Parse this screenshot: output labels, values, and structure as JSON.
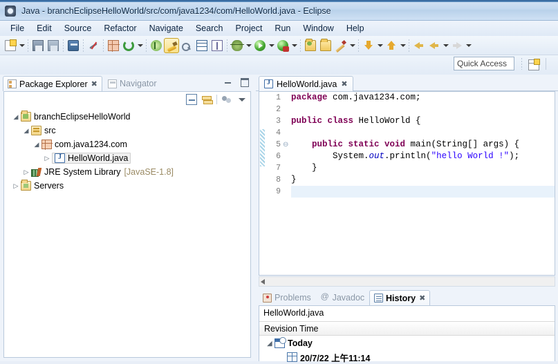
{
  "window": {
    "title": "Java - branchEclipseHelloWorld/src/com/java1234/com/HelloWorld.java - Eclipse",
    "app_icon": "eclipse-icon"
  },
  "menubar": {
    "items": [
      {
        "label": "File"
      },
      {
        "label": "Edit"
      },
      {
        "label": "Source"
      },
      {
        "label": "Refactor"
      },
      {
        "label": "Navigate"
      },
      {
        "label": "Search"
      },
      {
        "label": "Project"
      },
      {
        "label": "Run"
      },
      {
        "label": "Window"
      },
      {
        "label": "Help"
      }
    ]
  },
  "toolbar": {
    "buttons": [
      {
        "name": "new-wizard-icon",
        "icon": "ic-doc",
        "dropdown": true
      },
      {
        "sep": true
      },
      {
        "name": "save-icon",
        "icon": "ic-save"
      },
      {
        "name": "save-all-icon",
        "icon": "ic-saveall"
      },
      {
        "sep": true
      },
      {
        "name": "console-icon",
        "icon": "ic-console"
      },
      {
        "sep": true
      },
      {
        "name": "skip-breakpoints-icon",
        "icon": "ic-link"
      },
      {
        "sep": true
      },
      {
        "name": "new-java-class-icon",
        "icon": "ic-newclass"
      },
      {
        "name": "refresh-icon",
        "icon": "ic-refresh",
        "dropdown": true
      },
      {
        "sep": true
      },
      {
        "name": "debug-config-icon",
        "icon": "ic-debugc"
      },
      {
        "name": "brush-icon",
        "icon": "ic-brush",
        "selected": true
      },
      {
        "name": "search-next-icon",
        "icon": "ic-search2"
      },
      {
        "name": "open-task-icon",
        "icon": "ic-table"
      },
      {
        "name": "toggle-markers-icon",
        "icon": "ic-tbar"
      },
      {
        "sep": true
      },
      {
        "name": "debug-icon",
        "icon": "ic-bug",
        "dropdown": true
      },
      {
        "name": "run-icon",
        "icon": "ic-run",
        "dropdown": true
      },
      {
        "name": "coverage-icon",
        "icon": "ic-runred",
        "dropdown": true
      },
      {
        "sep": true
      },
      {
        "name": "open-type-icon",
        "icon": "ic-folder g"
      },
      {
        "name": "open-resource-icon",
        "icon": "ic-folder"
      },
      {
        "name": "external-tools-icon",
        "icon": "ic-pencil",
        "dropdown": true
      },
      {
        "sep": true
      },
      {
        "name": "previous-annotation-icon",
        "icon": "ic-down",
        "dropdown": true
      },
      {
        "name": "next-annotation-icon",
        "icon": "ic-up",
        "dropdown": true
      },
      {
        "sep": true
      },
      {
        "name": "back-icon",
        "icon": "ic-back"
      },
      {
        "name": "backward-history-icon",
        "icon": "ic-back",
        "dropdown": true
      },
      {
        "name": "forward-history-icon",
        "icon": "ic-fwd",
        "dropdown": true
      }
    ]
  },
  "quick_access": {
    "placeholder": "Quick Access",
    "value": "",
    "perspective_icon": "open-perspective-icon"
  },
  "package_explorer": {
    "tabs": [
      {
        "label": "Package Explorer",
        "icon": "package-explorer-icon",
        "active": true,
        "closable": true
      },
      {
        "label": "Navigator",
        "icon": "navigator-icon",
        "active": false,
        "closable": false
      }
    ],
    "window_buttons": [
      {
        "name": "minimize-button"
      },
      {
        "name": "maximize-button"
      }
    ],
    "view_tools": [
      {
        "name": "collapse-all-icon"
      },
      {
        "name": "link-with-editor-icon"
      },
      {
        "name": "view-filter-icon"
      },
      {
        "name": "view-menu-icon"
      }
    ],
    "tree": [
      {
        "label": "branchEclipseHelloWorld",
        "icon": "project-icon",
        "indent": 0,
        "twisty": "expanded",
        "selected": false
      },
      {
        "label": "src",
        "icon": "source-folder-icon",
        "indent": 1,
        "twisty": "expanded",
        "selected": false
      },
      {
        "label": "com.java1234.com",
        "icon": "package-icon",
        "indent": 2,
        "twisty": "expanded",
        "selected": false
      },
      {
        "label": "HelloWorld.java",
        "icon": "java-file-icon",
        "indent": 3,
        "twisty": "collapsed",
        "selected": true
      },
      {
        "label": "JRE System Library",
        "suffix": "[JavaSE-1.8]",
        "icon": "jre-library-icon",
        "indent": 1,
        "twisty": "collapsed",
        "selected": false
      },
      {
        "label": "Servers",
        "icon": "servers-folder-icon",
        "indent": 0,
        "twisty": "collapsed",
        "selected": false
      }
    ]
  },
  "editor": {
    "tab": {
      "label": "HelloWorld.java",
      "icon": "java-file-icon",
      "closable": true
    },
    "lines": [
      {
        "num": "1",
        "fold": false,
        "tokens": [
          {
            "t": "package",
            "c": "kw"
          },
          {
            "t": " com.java1234.com;",
            "c": ""
          }
        ]
      },
      {
        "num": "2",
        "fold": false,
        "tokens": []
      },
      {
        "num": "3",
        "fold": false,
        "tokens": [
          {
            "t": "public class",
            "c": "kw"
          },
          {
            "t": " HelloWorld {",
            "c": ""
          }
        ]
      },
      {
        "num": "4",
        "fold": false,
        "tokens": []
      },
      {
        "num": "5",
        "fold": true,
        "tokens": [
          {
            "t": "    ",
            "c": ""
          },
          {
            "t": "public static void",
            "c": "kw"
          },
          {
            "t": " main(String[] args) {",
            "c": ""
          }
        ]
      },
      {
        "num": "6",
        "fold": false,
        "tokens": [
          {
            "t": "        System.",
            "c": ""
          },
          {
            "t": "out",
            "c": "fld"
          },
          {
            "t": ".println(",
            "c": ""
          },
          {
            "t": "\"hello World !\"",
            "c": "str"
          },
          {
            "t": ");",
            "c": ""
          }
        ]
      },
      {
        "num": "7",
        "fold": false,
        "tokens": [
          {
            "t": "    }",
            "c": ""
          }
        ]
      },
      {
        "num": "8",
        "fold": false,
        "tokens": [
          {
            "t": "}",
            "c": ""
          }
        ]
      },
      {
        "num": "9",
        "fold": false,
        "tokens": [],
        "current": true
      }
    ]
  },
  "bottom_panel": {
    "tabs": [
      {
        "label": "Problems",
        "icon": "problems-icon",
        "active": false,
        "closable": false
      },
      {
        "label": "Javadoc",
        "icon": "javadoc-icon",
        "active": false,
        "closable": false
      },
      {
        "label": "History",
        "icon": "history-icon",
        "active": true,
        "closable": true
      }
    ],
    "filename": "HelloWorld.java",
    "column_header": "Revision Time",
    "rows": [
      {
        "label": "Today",
        "icon": "today-icon",
        "indent": 0,
        "twisty": "expanded"
      },
      {
        "label": "20/7/22 上午11:14",
        "icon": "revision-icon",
        "indent": 1,
        "twisty": ""
      }
    ]
  }
}
